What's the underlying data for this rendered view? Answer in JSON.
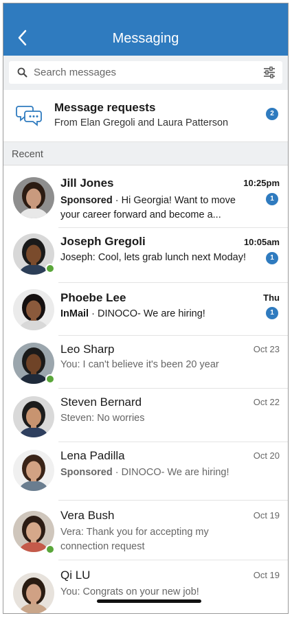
{
  "header": {
    "title": "Messaging",
    "back_icon": "chevron-left-icon"
  },
  "search": {
    "placeholder": "Search messages",
    "icon": "search-icon",
    "filter_icon": "sliders-icon"
  },
  "requests": {
    "title": "Message requests",
    "subtitle": "From Elan Gregoli and Laura Patterson",
    "count": "2",
    "icon": "chat-bubbles-icon"
  },
  "section": {
    "label": "Recent"
  },
  "colors": {
    "accent": "#2f7bbf",
    "online": "#5aa63a"
  },
  "conversations": [
    {
      "name": "Jill Jones",
      "time": "10:25pm",
      "tag": "Sponsored",
      "sep": " · ",
      "text": "Hi Georgia! Want to move your career forward and become a...",
      "badge": "1",
      "unread": true,
      "online": false
    },
    {
      "name": "Joseph Gregoli",
      "time": "10:05am",
      "tag": "",
      "sep": "",
      "text": "Joseph: Cool, lets grab lunch next Moday!",
      "badge": "1",
      "unread": true,
      "online": true
    },
    {
      "name": "Phoebe Lee",
      "time": "Thu",
      "tag": "InMail",
      "sep": " · ",
      "text": "DINOCO- We are hiring!",
      "badge": "1",
      "unread": true,
      "online": false
    },
    {
      "name": "Leo Sharp",
      "time": "Oct 23",
      "tag": "",
      "sep": "",
      "text": "You: I can't believe it's been 20 year",
      "badge": "",
      "unread": false,
      "online": true
    },
    {
      "name": "Steven Bernard",
      "time": "Oct 22",
      "tag": "",
      "sep": "",
      "text": "Steven: No worries",
      "badge": "",
      "unread": false,
      "online": false
    },
    {
      "name": "Lena Padilla",
      "time": "Oct 20",
      "tag": "Sponsored",
      "sep": " · ",
      "text": "DINOCO- We are hiring!",
      "badge": "",
      "unread": false,
      "online": false
    },
    {
      "name": "Vera Bush",
      "time": "Oct 19",
      "tag": "",
      "sep": "",
      "text": "Vera: Thank you for accepting my connection request",
      "badge": "",
      "unread": false,
      "online": true
    },
    {
      "name": "Qi LU",
      "time": "Oct 19",
      "tag": "",
      "sep": "",
      "text": "You: Congrats on your new job!",
      "badge": "",
      "unread": false,
      "online": false
    }
  ]
}
